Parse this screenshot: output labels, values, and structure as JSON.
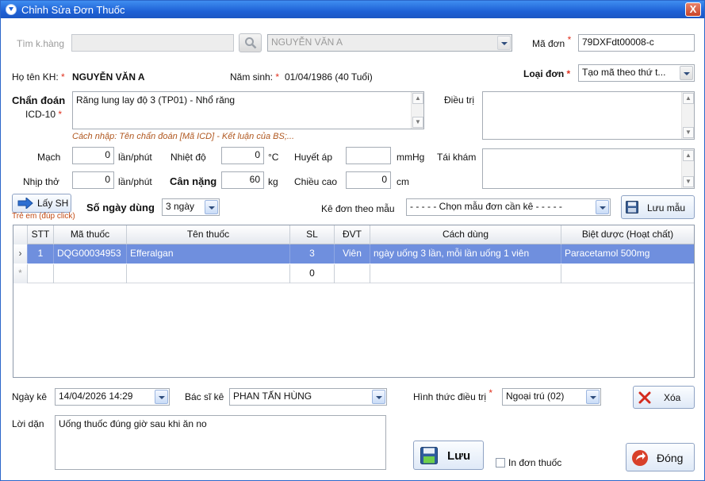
{
  "window": {
    "title": "Chỉnh Sửa Đơn Thuốc",
    "close_label": "X"
  },
  "search": {
    "label": "Tìm k.hàng",
    "value": "",
    "patient_combo": "NGUYỄN VĂN A"
  },
  "order": {
    "ma_don_label": "Mã đơn",
    "ma_don_value": "79DXFdt00008-c",
    "loai_don_label": "Loại đơn",
    "loai_don_value": "Tạo mã theo thứ t..."
  },
  "patient": {
    "name_label": "Họ tên KH:",
    "name": "NGUYỄN VĂN A",
    "dob_label": "Năm sinh:",
    "dob": "01/04/1986 (40 Tuổi)"
  },
  "diagnosis": {
    "label1": "Chẩn đoán",
    "label2": "ICD-10",
    "value": "Răng lung lay độ 3 (TP01) - Nhổ răng",
    "hint": "Cách nhập: Tên chẩn đoán [Mã ICD] - Kết luận của BS;...",
    "dieu_tri_label": "Điều trị",
    "dieu_tri_value": "",
    "tai_kham_label": "Tái khám",
    "tai_kham_value": ""
  },
  "vitals": {
    "mach_label": "Mạch",
    "mach_value": "0",
    "mach_unit": "lần/phút",
    "nhiet_do_label": "Nhiệt độ",
    "nhiet_do_value": "0",
    "nhiet_do_unit": "°C",
    "huyet_ap_label": "Huyết áp",
    "huyet_ap_value": "",
    "huyet_ap_unit": "mmHg",
    "nhip_tho_label": "Nhịp thở",
    "nhip_tho_value": "0",
    "nhip_tho_unit": "lần/phút",
    "can_nang_label": "Cân nặng",
    "can_nang_value": "60",
    "can_nang_unit": "kg",
    "chieu_cao_label": "Chiều cao",
    "chieu_cao_value": "0",
    "chieu_cao_unit": "cm"
  },
  "toolbar": {
    "lay_sh_label": "Lấy SH",
    "tre_em_note": "Trẻ em (đúp click)",
    "so_ngay_label": "Số ngày dùng",
    "so_ngay_value": "3 ngày",
    "ke_don_label": "Kê đơn theo mẫu",
    "ke_don_value": "- - - - - Chọn mẫu đơn cần kê - - - - -",
    "luu_mau_label": "Lưu mẫu"
  },
  "grid": {
    "headers": {
      "stt": "STT",
      "ma_thuoc": "Mã thuốc",
      "ten_thuoc": "Tên thuốc",
      "sl": "SL",
      "dvt": "ĐVT",
      "cach_dung": "Cách dùng",
      "biet_duoc": "Biệt dược (Hoạt chất)"
    },
    "row1": {
      "marker": "›",
      "stt": "1",
      "ma_thuoc": "DQG00034953",
      "ten_thuoc": "Efferalgan",
      "sl": "3",
      "dvt": "Viên",
      "cach_dung": "ngày uống 3 lần, mỗi lần uống 1 viên",
      "biet_duoc": "Paracetamol 500mg"
    },
    "new_row": {
      "marker": "*",
      "sl": "0"
    }
  },
  "footer": {
    "ngay_ke_label": "Ngày kê",
    "ngay_ke_value": "14/04/2026 14:29",
    "bac_si_label": "Bác sĩ kê",
    "bac_si_value": "PHAN TẤN HÙNG",
    "hinh_thuc_label": "Hình thức điều trị",
    "hinh_thuc_value": "Ngoại trú (02)",
    "xoa_label": "Xóa",
    "loi_dan_label": "Lời dặn",
    "loi_dan_value": "Uống thuốc đúng giờ sau khi ăn no",
    "luu_label": "Lưu",
    "in_don_label": "In đơn thuốc",
    "dong_label": "Đóng"
  },
  "colors": {
    "title_bar": "#1e61d6",
    "selected_row": "#6f8fde",
    "required_star": "#e0301e",
    "hint": "#b0571f"
  }
}
